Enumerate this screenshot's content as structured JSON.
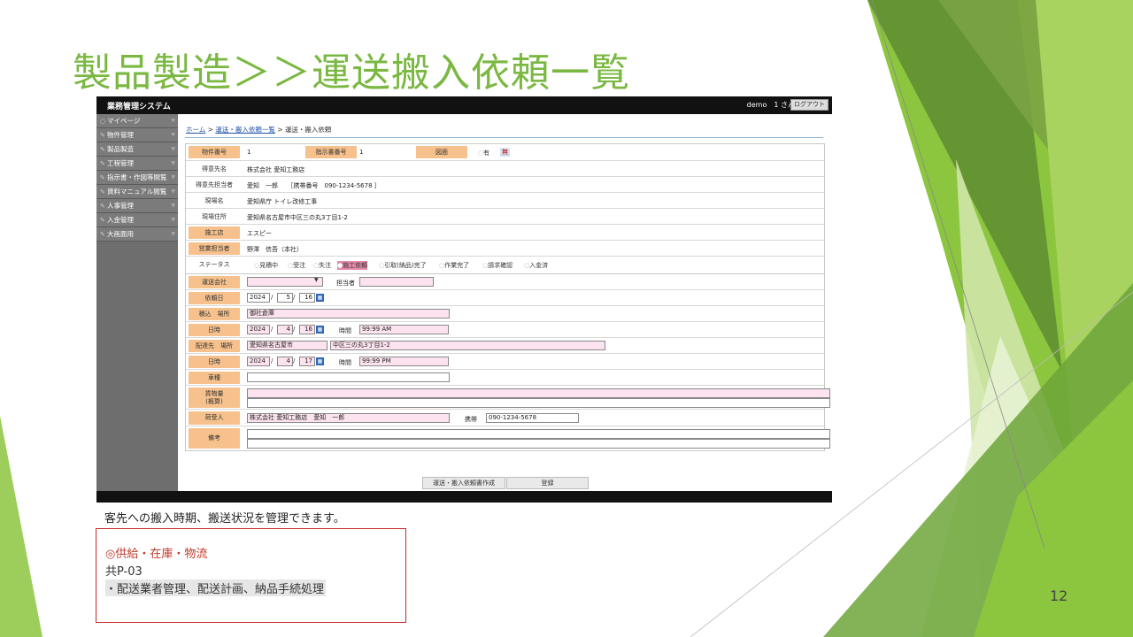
{
  "slide_title": "製品製造＞＞運送搬入依頼一覧",
  "caption": "客先への搬入時期、搬送状況を管理できます。",
  "note": {
    "line1": "◎供給・在庫・物流",
    "line2": "共P-03",
    "line3": "・配送業者管理、配送計画、納品手続処理"
  },
  "page_number": "12",
  "app": {
    "title": "業務管理システム",
    "user": "demo　1 さん",
    "logout": "ログアウト",
    "sidebar": [
      {
        "label": "マイページ",
        "icon": "home-icon"
      },
      {
        "label": "物件管理",
        "icon": "pencil-icon"
      },
      {
        "label": "製品製造",
        "icon": "pencil-icon"
      },
      {
        "label": "工程管理",
        "icon": "pencil-icon"
      },
      {
        "label": "指示書・作図等閲覧",
        "icon": "pencil-icon"
      },
      {
        "label": "資料マニュアル閲覧",
        "icon": "pencil-icon"
      },
      {
        "label": "人事管理",
        "icon": "pencil-icon"
      },
      {
        "label": "入金管理",
        "icon": "pencil-icon"
      },
      {
        "label": "大画面用",
        "icon": "pencil-icon"
      }
    ],
    "breadcrumb": {
      "home": "ホーム",
      "sep": ">",
      "list": "運送・搬入依頼一覧",
      "current": "運送・搬入依頼"
    },
    "info": {
      "property_no_label": "物件番号",
      "property_no": "1",
      "instruction_no_label": "指示書番号",
      "instruction_no": "1",
      "drawing_label": "図面",
      "drawing_yes": "有",
      "drawing_no": "無",
      "client_label": "得意先名",
      "client": "株式会社 愛知工務店",
      "client_contact_label": "得意先担当者",
      "client_contact": "愛知　一郎　　［携帯番号　090-1234-5678 ］",
      "site_label": "現場名",
      "site": "愛知県庁 トイレ改修工事",
      "site_address_label": "現場住所",
      "site_address": "愛知県名古屋市中区三の丸3丁目1-2",
      "contractor_label": "施工店",
      "contractor": "エスピー",
      "sales_label": "営業担当者",
      "sales": "野澤　信吾（本社）",
      "status_label": "ステータス",
      "statuses": [
        "見積中",
        "受注",
        "失注",
        "施工依頼",
        "引取(納品)完了",
        "作業完了",
        "請求確認",
        "入金済"
      ],
      "status_selected": "施工依頼"
    },
    "request": {
      "carrier_label": "運送会社",
      "carrier_value": "",
      "person_label": "担当者",
      "person_value": "",
      "request_date_label": "依頼日",
      "request_date": {
        "y": "2024",
        "m": "5",
        "d": "16"
      },
      "loading_place_label": "積込　場所",
      "loading_place": "御社倉庫",
      "loading_dt_label": "日時",
      "loading_date": {
        "y": "2024",
        "m": "4",
        "d": "16"
      },
      "time_label": "時間",
      "loading_time": "99:99 AM",
      "delivery_place_label": "配達先　場所",
      "delivery_place1": "愛知県名古屋市",
      "delivery_place2": "中区三の丸3丁目1-2",
      "delivery_dt_label": "日時",
      "delivery_date": {
        "y": "2024",
        "m": "4",
        "d": "17"
      },
      "delivery_time": "99:99 PM",
      "vehicle_label": "車種",
      "vehicle": "",
      "cargo_label": "貨物量\n(概算)",
      "cargo": "",
      "receiver_label": "荷受人",
      "receiver": "株式会社 愛知工務店　愛知　一郎",
      "mobile_label": "携帯",
      "mobile": "090-1234-5678",
      "remarks_label": "備考",
      "remarks": ""
    },
    "buttons": {
      "create": "運送・搬入依頼書作成",
      "register": "登録"
    }
  },
  "colors": {
    "title_green": "#7ab842",
    "label_orange": "#f6c18c",
    "input_pink": "#fde3ef",
    "note_border": "#c62828"
  }
}
